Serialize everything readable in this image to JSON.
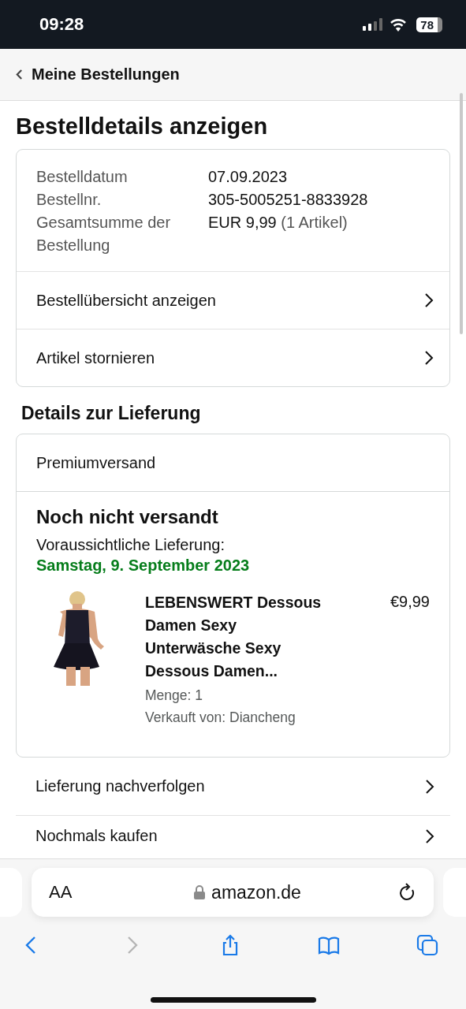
{
  "status_bar": {
    "time": "09:28",
    "battery": "78"
  },
  "nav": {
    "back_label": "Meine Bestellungen"
  },
  "title": "Bestelldetails anzeigen",
  "order_summary": {
    "fields": [
      {
        "label": "Bestelldatum",
        "value": "07.09.2023"
      },
      {
        "label": "Bestellnr.",
        "value": "305-5005251-8833928"
      },
      {
        "label": "Gesamtsumme der Bestellung",
        "value": "EUR 9,99",
        "note": "(1 Artikel)"
      }
    ],
    "links": [
      "Bestellübersicht anzeigen",
      "Artikel stornieren"
    ]
  },
  "delivery": {
    "heading": "Details zur Lieferung",
    "shipping_method": "Premiumversand",
    "status": "Noch nicht versandt",
    "estimate_label": "Voraussichtliche Lieferung:",
    "estimate_date": "Samstag, 9. September 2023",
    "item": {
      "title": "LEBENSWERT Dessous Damen Sexy Unterwäsche Sexy Dessous Damen...",
      "price": "€9,99",
      "quantity": "Menge: 1",
      "seller": "Verkauft von: Diancheng"
    }
  },
  "actions": [
    "Lieferung nachverfolgen",
    "Nochmals kaufen"
  ],
  "browser": {
    "text_size": "AA",
    "url": "amazon.de",
    "toolbar": [
      {
        "kind": "back",
        "disabled": false
      },
      {
        "kind": "forward",
        "disabled": true
      },
      {
        "kind": "share",
        "disabled": false
      },
      {
        "kind": "bookmarks",
        "disabled": false
      },
      {
        "kind": "tabs",
        "disabled": false
      }
    ]
  }
}
